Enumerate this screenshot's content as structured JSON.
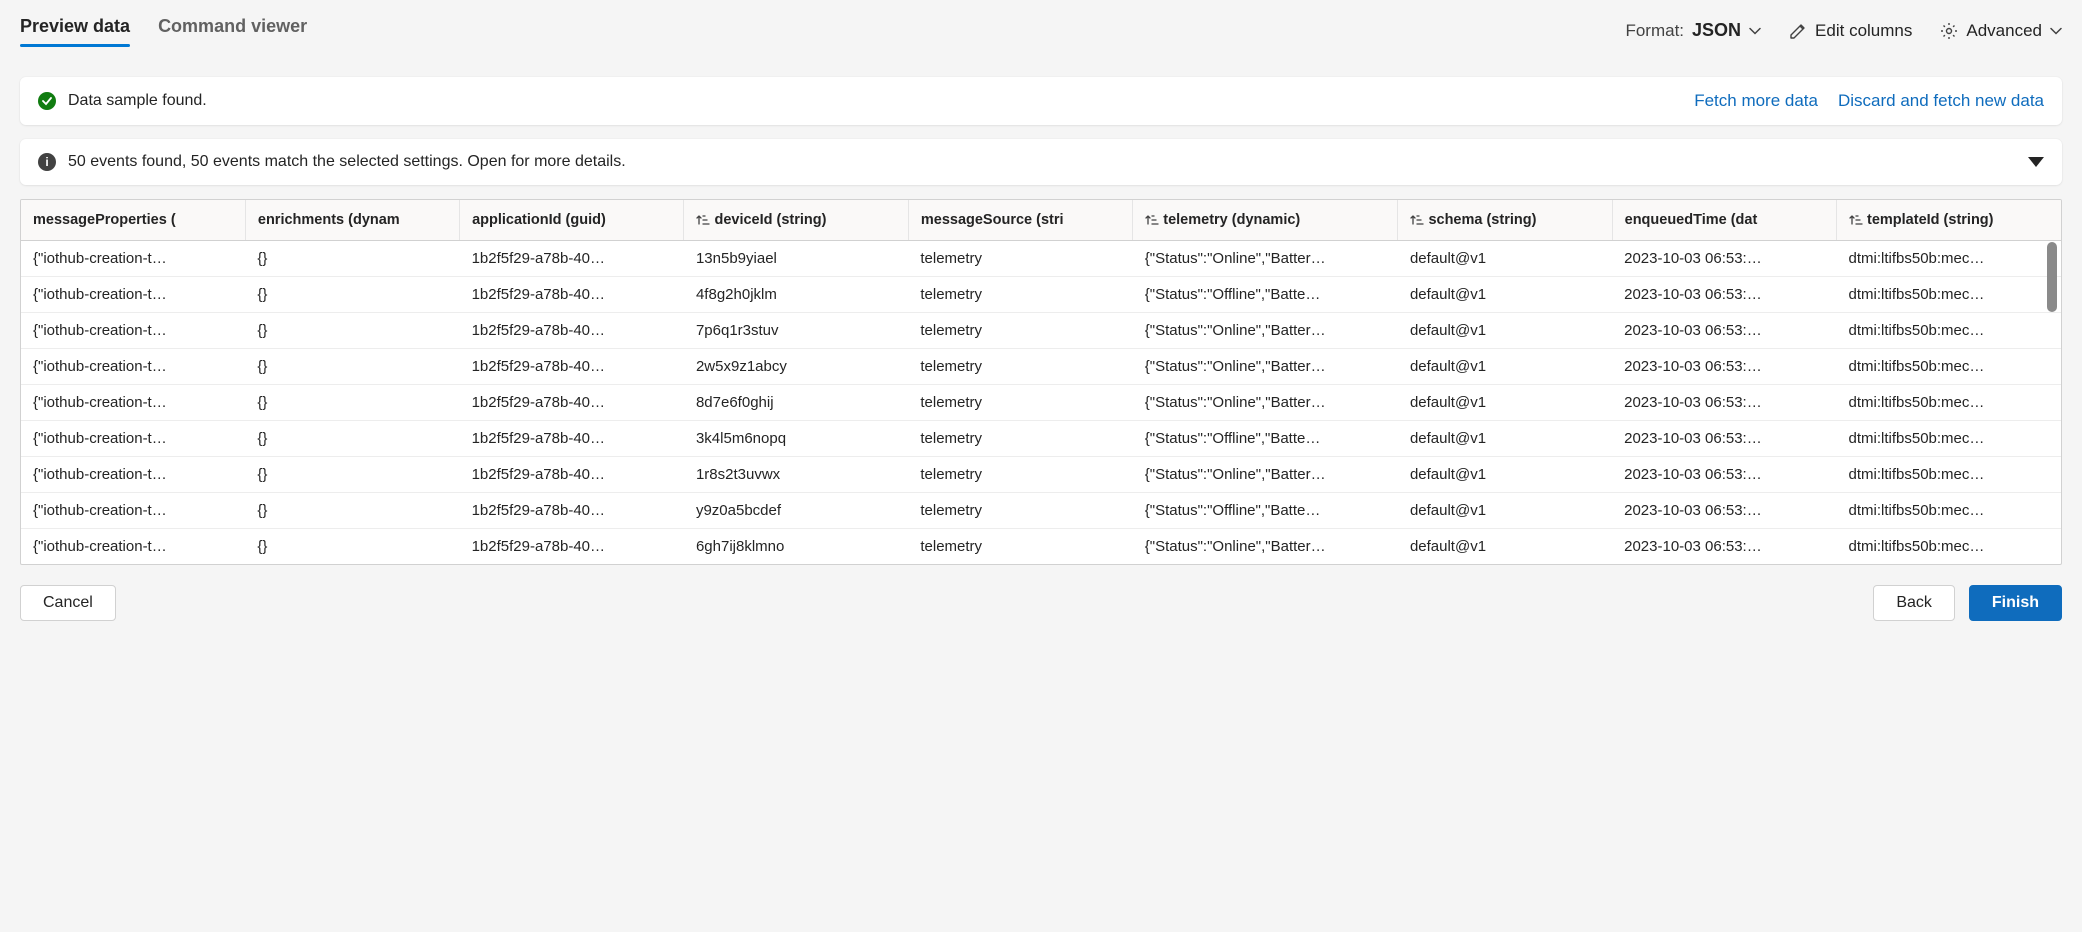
{
  "tabs": {
    "preview": "Preview data",
    "command": "Command viewer"
  },
  "controls": {
    "format_label": "Format:",
    "format_value": "JSON",
    "edit_columns": "Edit columns",
    "advanced": "Advanced"
  },
  "status_card": {
    "message": "Data sample found.",
    "fetch_more": "Fetch more data",
    "discard": "Discard and fetch new data"
  },
  "events_card": {
    "message": "50 events found, 50 events match the selected settings. Open for more details."
  },
  "table": {
    "columns": [
      {
        "label": "messageProperties (",
        "sortable": false
      },
      {
        "label": "enrichments (dynam",
        "sortable": false
      },
      {
        "label": "applicationId (guid)",
        "sortable": false
      },
      {
        "label": "deviceId (string)",
        "sortable": true
      },
      {
        "label": "messageSource (stri",
        "sortable": false
      },
      {
        "label": "telemetry (dynamic)",
        "sortable": true
      },
      {
        "label": "schema (string)",
        "sortable": true
      },
      {
        "label": "enqueuedTime (dat",
        "sortable": false
      },
      {
        "label": "templateId (string)",
        "sortable": true
      }
    ],
    "rows": [
      {
        "messageProperties": "{\"iothub-creation-t…",
        "enrichments": "{}",
        "applicationId": "1b2f5f29-a78b-40…",
        "deviceId": "13n5b9yiael",
        "messageSource": "telemetry",
        "telemetry": "{\"Status\":\"Online\",\"Batter…",
        "schema": "default@v1",
        "enqueuedTime": "2023-10-03 06:53:…",
        "templateId": "dtmi:ltifbs50b:mec…"
      },
      {
        "messageProperties": "{\"iothub-creation-t…",
        "enrichments": "{}",
        "applicationId": "1b2f5f29-a78b-40…",
        "deviceId": "4f8g2h0jklm",
        "messageSource": "telemetry",
        "telemetry": "{\"Status\":\"Offline\",\"Batte…",
        "schema": "default@v1",
        "enqueuedTime": "2023-10-03 06:53:…",
        "templateId": "dtmi:ltifbs50b:mec…"
      },
      {
        "messageProperties": "{\"iothub-creation-t…",
        "enrichments": "{}",
        "applicationId": "1b2f5f29-a78b-40…",
        "deviceId": "7p6q1r3stuv",
        "messageSource": "telemetry",
        "telemetry": "{\"Status\":\"Online\",\"Batter…",
        "schema": "default@v1",
        "enqueuedTime": "2023-10-03 06:53:…",
        "templateId": "dtmi:ltifbs50b:mec…"
      },
      {
        "messageProperties": "{\"iothub-creation-t…",
        "enrichments": "{}",
        "applicationId": "1b2f5f29-a78b-40…",
        "deviceId": "2w5x9z1abcy",
        "messageSource": "telemetry",
        "telemetry": "{\"Status\":\"Online\",\"Batter…",
        "schema": "default@v1",
        "enqueuedTime": "2023-10-03 06:53:…",
        "templateId": "dtmi:ltifbs50b:mec…"
      },
      {
        "messageProperties": "{\"iothub-creation-t…",
        "enrichments": "{}",
        "applicationId": "1b2f5f29-a78b-40…",
        "deviceId": "8d7e6f0ghij",
        "messageSource": "telemetry",
        "telemetry": "{\"Status\":\"Online\",\"Batter…",
        "schema": "default@v1",
        "enqueuedTime": "2023-10-03 06:53:…",
        "templateId": "dtmi:ltifbs50b:mec…"
      },
      {
        "messageProperties": "{\"iothub-creation-t…",
        "enrichments": "{}",
        "applicationId": "1b2f5f29-a78b-40…",
        "deviceId": "3k4l5m6nopq",
        "messageSource": "telemetry",
        "telemetry": "{\"Status\":\"Offline\",\"Batte…",
        "schema": "default@v1",
        "enqueuedTime": "2023-10-03 06:53:…",
        "templateId": "dtmi:ltifbs50b:mec…"
      },
      {
        "messageProperties": "{\"iothub-creation-t…",
        "enrichments": "{}",
        "applicationId": "1b2f5f29-a78b-40…",
        "deviceId": "1r8s2t3uvwx",
        "messageSource": "telemetry",
        "telemetry": "{\"Status\":\"Online\",\"Batter…",
        "schema": "default@v1",
        "enqueuedTime": "2023-10-03 06:53:…",
        "templateId": "dtmi:ltifbs50b:mec…"
      },
      {
        "messageProperties": "{\"iothub-creation-t…",
        "enrichments": "{}",
        "applicationId": "1b2f5f29-a78b-40…",
        "deviceId": "y9z0a5bcdef",
        "messageSource": "telemetry",
        "telemetry": "{\"Status\":\"Offline\",\"Batte…",
        "schema": "default@v1",
        "enqueuedTime": "2023-10-03 06:53:…",
        "templateId": "dtmi:ltifbs50b:mec…"
      },
      {
        "messageProperties": "{\"iothub-creation-t…",
        "enrichments": "{}",
        "applicationId": "1b2f5f29-a78b-40…",
        "deviceId": "6gh7ij8klmno",
        "messageSource": "telemetry",
        "telemetry": "{\"Status\":\"Online\",\"Batter…",
        "schema": "default@v1",
        "enqueuedTime": "2023-10-03 06:53:…",
        "templateId": "dtmi:ltifbs50b:mec…"
      }
    ]
  },
  "footer": {
    "cancel": "Cancel",
    "back": "Back",
    "finish": "Finish"
  }
}
